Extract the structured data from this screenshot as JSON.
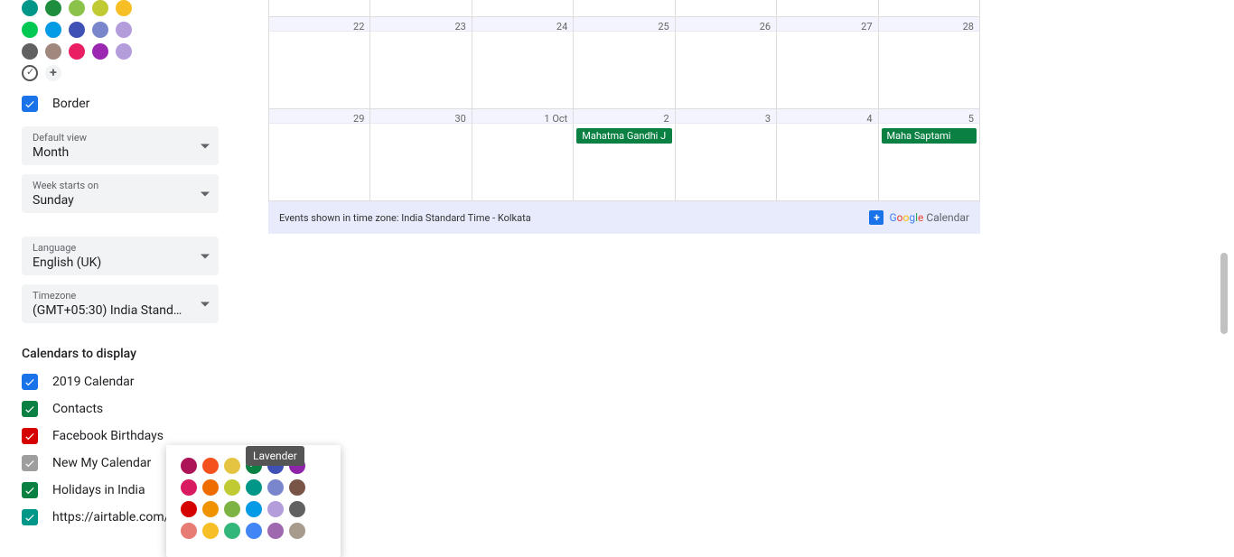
{
  "colorPalette": {
    "row1": [
      "#009688",
      "#1e8e3e",
      "#8bc34a",
      "#c0ca33",
      "#f6bf26"
    ],
    "row2": [
      "#00c853",
      "#039be5",
      "#3f51b5",
      "#7986cb",
      "#b39ddb"
    ],
    "row3": [
      "#616161",
      "#a1887f",
      "#e91e63",
      "#9c27b0",
      "#b39ddb"
    ]
  },
  "border_checkbox": {
    "label": "Border",
    "checked": true,
    "color": "#1a73e8"
  },
  "dropdowns": {
    "default_view": {
      "label": "Default view",
      "value": "Month"
    },
    "week_starts": {
      "label": "Week starts on",
      "value": "Sunday"
    },
    "language": {
      "label": "Language",
      "value": "English (UK)"
    },
    "timezone": {
      "label": "Timezone",
      "value": "(GMT+05:30) India Standar…"
    }
  },
  "calendars_section": {
    "title": "Calendars to display"
  },
  "calendar_list": [
    {
      "label": "2019 Calendar",
      "color": "#1a73e8"
    },
    {
      "label": "Contacts",
      "color": "#0b8043"
    },
    {
      "label": "Facebook Birthdays",
      "color": "#d50000"
    },
    {
      "label": "New My Calendar",
      "color": "#9e9e9e"
    },
    {
      "label": "Holidays in India",
      "color": "#0b8043"
    },
    {
      "label": "https://airtable.com/",
      "color": "#009688"
    }
  ],
  "grid": {
    "week1": [
      "",
      "",
      "",
      "",
      "",
      "",
      ""
    ],
    "week2": [
      "22",
      "23",
      "24",
      "25",
      "26",
      "27",
      "28"
    ],
    "week3": [
      "29",
      "30",
      "1 Oct",
      "2",
      "3",
      "4",
      "5"
    ],
    "events": {
      "gandhi": "Mahatma Gandhi J",
      "saptami": "Maha Saptami"
    }
  },
  "footer": {
    "tz": "Events shown in time zone: India Standard Time - Kolkata",
    "brand": "Calendar"
  },
  "popup": {
    "tooltip": "Lavender",
    "row1": [
      "#ad1457",
      "#f4511e",
      "#e4c441",
      "#0b8043",
      "#3f51b5",
      "#8e24aa"
    ],
    "row2": [
      "#d81b60",
      "#ef6c00",
      "#c0ca33",
      "#009688",
      "#7986cb",
      "#795548"
    ],
    "row3": [
      "#d50000",
      "#f09300",
      "#7cb342",
      "#039be5",
      "#b39ddb",
      "#616161"
    ],
    "row4": [
      "#e67c73",
      "#f6bf26",
      "#33b679",
      "#4285f4",
      "#9e69af",
      "#a79b8e"
    ],
    "checked_index": 3
  }
}
